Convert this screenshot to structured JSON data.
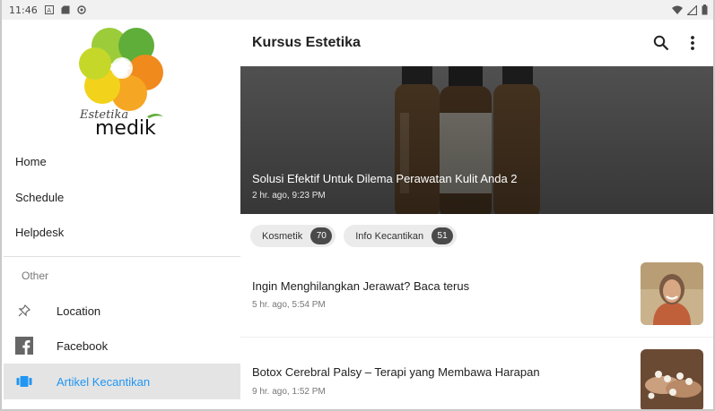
{
  "status_bar": {
    "time": "11:46"
  },
  "drawer": {
    "logo": {
      "script_text": "Estetika",
      "brand_text": "medik"
    },
    "primary_items": [
      {
        "label": "Home"
      },
      {
        "label": "Schedule"
      },
      {
        "label": "Helpdesk"
      }
    ],
    "section_label": "Other",
    "secondary_items": [
      {
        "label": "Location",
        "icon": "pin-icon"
      },
      {
        "label": "Facebook",
        "icon": "facebook-icon"
      },
      {
        "label": "Artikel Kecantikan",
        "icon": "article-icon",
        "active": true
      }
    ]
  },
  "appbar": {
    "title": "Kursus Estetika",
    "actions": [
      "search-icon",
      "more-vert-icon"
    ]
  },
  "featured": {
    "title": "Solusi Efektif Untuk Dilema Perawatan Kulit Anda 2",
    "meta": "2 hr. ago, 9:23 PM"
  },
  "categories": [
    {
      "label": "Kosmetik",
      "count": "70"
    },
    {
      "label": "Info Kecantikan",
      "count": "51"
    }
  ],
  "articles": [
    {
      "title": "Ingin Menghilangkan Jerawat? Baca terus",
      "meta": "5 hr. ago, 5:54 PM"
    },
    {
      "title": "Botox Cerebral Palsy – Terapi yang Membawa Harapan",
      "meta": "9 hr. ago, 1:52 PM"
    }
  ],
  "colors": {
    "accent": "#2196f3",
    "active_bg": "#e4e4e4",
    "chip_bg": "#ebebeb",
    "chip_count_bg": "#4a4a4a"
  }
}
